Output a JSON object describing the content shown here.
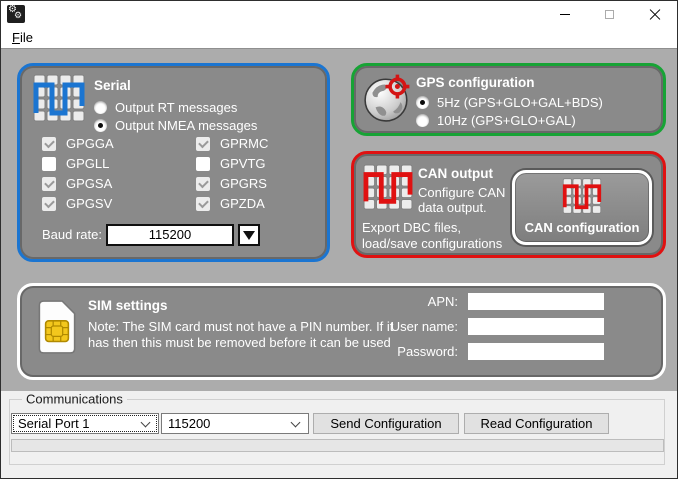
{
  "titlebar": {
    "icons": {
      "app": "gears-icon",
      "minimize": "minimize-icon",
      "maximize": "maximize-icon",
      "close": "close-icon"
    }
  },
  "menubar": {
    "file_accel": "F",
    "file_rest": "ile"
  },
  "serial": {
    "title": "Serial",
    "icon": "serial-signal-icon",
    "accent_color": "#1b75d1",
    "radio_rt": {
      "label": "Output RT messages",
      "selected": false
    },
    "radio_nmea": {
      "label": "Output NMEA messages",
      "selected": true
    },
    "col1": [
      {
        "label": "GPGGA",
        "checked": true
      },
      {
        "label": "GPGLL",
        "checked": false
      },
      {
        "label": "GPGSA",
        "checked": true
      },
      {
        "label": "GPGSV",
        "checked": true
      }
    ],
    "col2": [
      {
        "label": "GPRMC",
        "checked": true
      },
      {
        "label": "GPVTG",
        "checked": false
      },
      {
        "label": "GPGRS",
        "checked": true
      },
      {
        "label": "GPZDA",
        "checked": true
      }
    ],
    "baud_label": "Baud rate:",
    "baud_value": "115200"
  },
  "gps": {
    "title": "GPS configuration",
    "icon": "globe-target-icon",
    "accent_color": "#17a335",
    "radio_5hz": {
      "label": "5Hz (GPS+GLO+GAL+BDS)",
      "selected": true
    },
    "radio_10hz": {
      "label": "10Hz (GPS+GLO+GAL)",
      "selected": false
    }
  },
  "can": {
    "title": "CAN output",
    "icon": "can-signal-icon",
    "accent_color": "#e01111",
    "desc1": "Configure CAN",
    "desc2": "data output.",
    "desc3": "Export DBC files,",
    "desc4": "load/save configurations",
    "button_label": "CAN configuration"
  },
  "sim": {
    "title": "SIM settings",
    "icon": "sim-card-icon",
    "note1": "Note: The SIM card must not have a PIN number. If it",
    "note2": "has then this must be removed before it can be used",
    "apn": {
      "label": "APN:",
      "value": ""
    },
    "username": {
      "label": "User name:",
      "value": ""
    },
    "password": {
      "label": "Password:",
      "value": ""
    }
  },
  "communications": {
    "title": "Communications",
    "port_value": "Serial Port 1",
    "baud_value": "115200",
    "send_label": "Send Configuration",
    "read_label": "Read Configuration",
    "progress_percent": 0
  }
}
